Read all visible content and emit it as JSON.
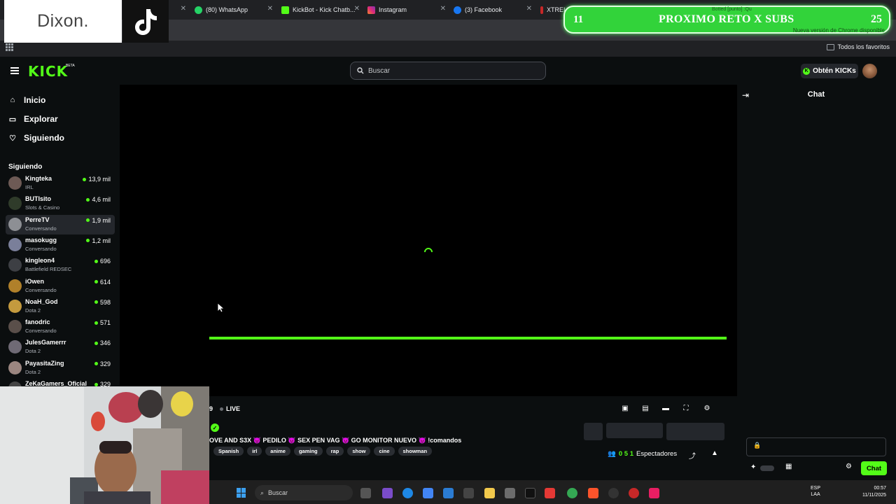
{
  "browser": {
    "tabs": [
      {
        "label": "(80) WhatsApp",
        "color": "#25d366"
      },
      {
        "label": "KickBot - Kick Chatb...",
        "color": "#53fc18"
      },
      {
        "label": "Instagram",
        "color": "#e1306c"
      },
      {
        "label": "(3) Facebook",
        "color": "#1877f2"
      },
      {
        "label": "XTREI",
        "color": "#c62828"
      }
    ],
    "bookmarks_all": "Todos los favoritos",
    "update_notice": "Nueva versión de Chrome disponible",
    "tab_partial": "Botted [punto] :Qu"
  },
  "overlays": {
    "brand_text": "Dixon.",
    "tiktok_icon": "tiktok-icon",
    "goal": {
      "left_number": "11",
      "text": "PROXIMO RETO X SUBS",
      "right_number": "25"
    }
  },
  "kick": {
    "logo": "KICK",
    "logo_badge": "BETA",
    "search_placeholder": "Buscar",
    "get_kicks_label": "Obtén KICKs",
    "nav": [
      {
        "label": "Inicio",
        "icon": "home-icon"
      },
      {
        "label": "Explorar",
        "icon": "compass-icon"
      },
      {
        "label": "Siguiendo",
        "icon": "heart-icon"
      }
    ],
    "following_heading": "Siguiendo",
    "channels": [
      {
        "name": "Kingteka",
        "category": "IRL",
        "viewers": "13,9 mil",
        "color": "#6d5a55"
      },
      {
        "name": "BUTIsito",
        "category": "Slots & Casino",
        "viewers": "4,6 mil",
        "color": "#2f3b2a"
      },
      {
        "name": "PerreTV",
        "category": "Conversando",
        "viewers": "1,9 mil",
        "color": "#8d8f94",
        "active": true
      },
      {
        "name": "masokugg",
        "category": "Conversando",
        "viewers": "1,2 mil",
        "color": "#7a7f9a"
      },
      {
        "name": "kingleon4",
        "category": "Battlefield REDSEC",
        "viewers": "696",
        "color": "#3d3f44"
      },
      {
        "name": "iOwen",
        "category": "Conversando",
        "viewers": "614",
        "color": "#b0802a"
      },
      {
        "name": "NoaH_God",
        "category": "Dota 2",
        "viewers": "598",
        "color": "#c49a3e"
      },
      {
        "name": "fanodric",
        "category": "Conversando",
        "viewers": "571",
        "color": "#5a4f4a"
      },
      {
        "name": "JulesGamerrr",
        "category": "Dota 2",
        "viewers": "346",
        "color": "#6f6a75"
      },
      {
        "name": "PayasitaZing",
        "category": "Dota 2",
        "viewers": "329",
        "color": "#9b8680"
      },
      {
        "name": "ZeKaGamers_Oficial",
        "category": "",
        "viewers": "329",
        "color": "#444"
      }
    ],
    "player": {
      "viewer_prefix": "9",
      "live_label": "LIVE",
      "progress": 1.0
    },
    "stream": {
      "title": "OVE AND S3X 😈 PEDILO 😈 SEX PEN VAG 😈 GO MONITOR NUEVO 😈 !comandos",
      "tags": [
        "Spanish",
        "irl",
        "anime",
        "gaming",
        "rap",
        "show",
        "cine",
        "showman"
      ],
      "viewer_count": "0 5 1",
      "viewers_label": "Espectadores"
    },
    "chat": {
      "title": "Chat",
      "send_label": "Chat"
    }
  },
  "taskbar": {
    "search_placeholder": "Buscar",
    "lang_top": "ESP",
    "lang_bottom": "LAA",
    "time": "00:57",
    "date": "11/11/2025"
  }
}
